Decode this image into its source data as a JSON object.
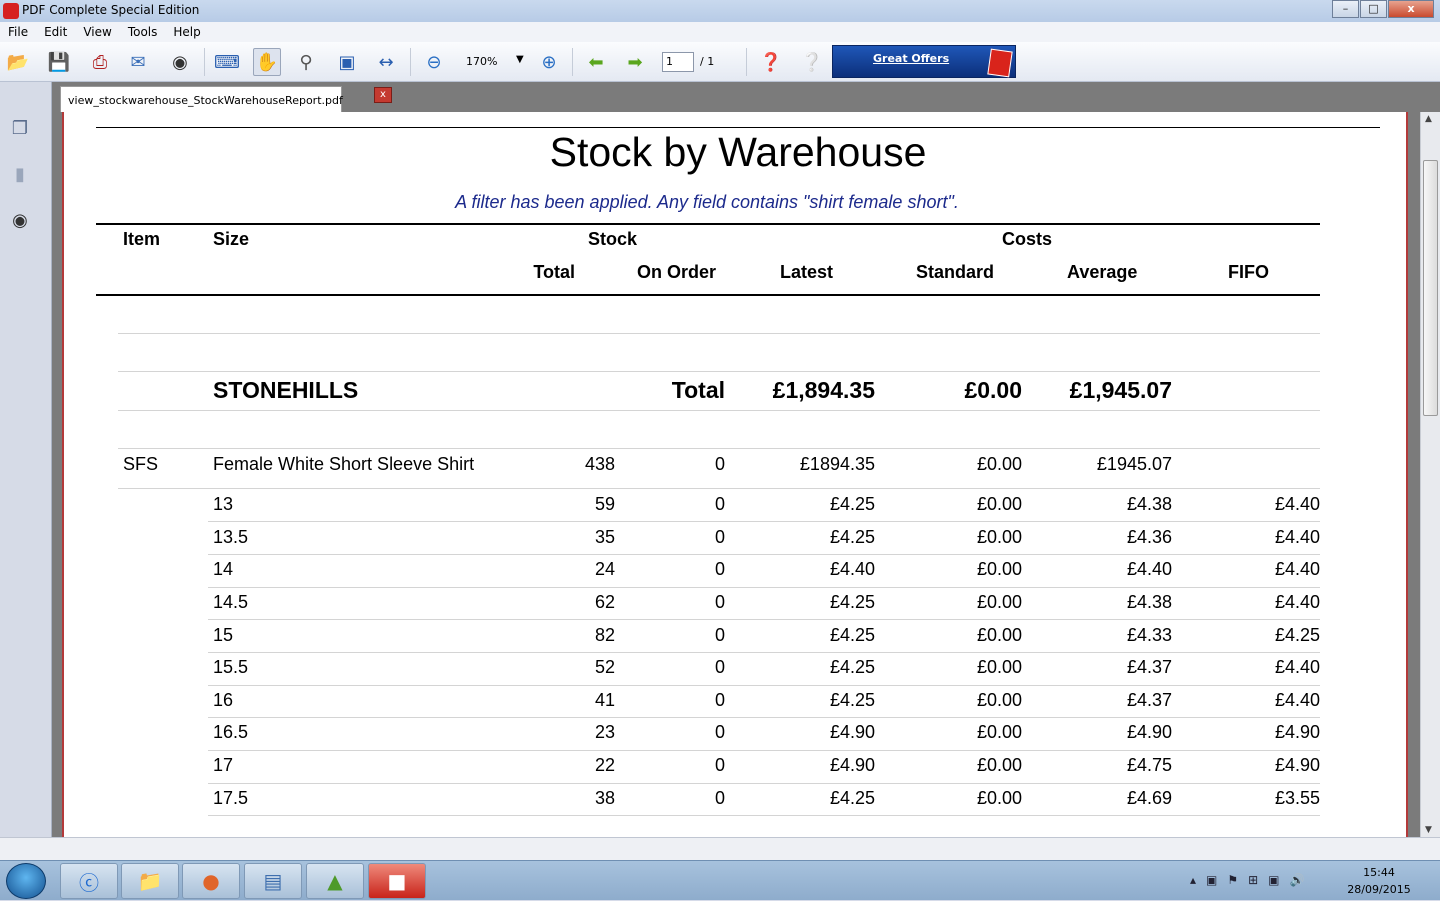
{
  "window": {
    "title": "PDF Complete Special Edition",
    "minimize": "–",
    "restore": "□",
    "close": "x"
  },
  "menu": [
    "File",
    "Edit",
    "View",
    "Tools",
    "Help"
  ],
  "toolbar": {
    "zoom": "170%",
    "page_current": "1",
    "page_total": "/ 1",
    "offers_label": "Great Offers"
  },
  "tab": {
    "filename": "view_stockwarehouse_StockWarehouseReport.pdf",
    "close": "x"
  },
  "report": {
    "title": "Stock by Warehouse",
    "filter_text": "A filter has been applied.  Any field contains  \"shirt female short\".",
    "headers": {
      "item": "Item",
      "size": "Size",
      "stock": "Stock",
      "costs": "Costs",
      "total": "Total",
      "on_order": "On Order",
      "latest": "Latest",
      "standard": "Standard",
      "average": "Average",
      "fifo": "FIFO"
    },
    "warehouse": {
      "name": "STONEHILLS",
      "total_label": "Total",
      "latest": "£1,894.35",
      "standard": "£0.00",
      "average": "£1,945.07"
    },
    "item": {
      "code": "SFS",
      "description": "Female White Short Sleeve Shirt",
      "total": "438",
      "on_order": "0",
      "latest": "£1894.35",
      "standard": "£0.00",
      "average": "£1945.07"
    },
    "rows": [
      {
        "size": "13",
        "total": "59",
        "on_order": "0",
        "latest": "£4.25",
        "standard": "£0.00",
        "average": "£4.38",
        "fifo": "£4.40"
      },
      {
        "size": "13.5",
        "total": "35",
        "on_order": "0",
        "latest": "£4.25",
        "standard": "£0.00",
        "average": "£4.36",
        "fifo": "£4.40"
      },
      {
        "size": "14",
        "total": "24",
        "on_order": "0",
        "latest": "£4.40",
        "standard": "£0.00",
        "average": "£4.40",
        "fifo": "£4.40"
      },
      {
        "size": "14.5",
        "total": "62",
        "on_order": "0",
        "latest": "£4.25",
        "standard": "£0.00",
        "average": "£4.38",
        "fifo": "£4.40"
      },
      {
        "size": "15",
        "total": "82",
        "on_order": "0",
        "latest": "£4.25",
        "standard": "£0.00",
        "average": "£4.33",
        "fifo": "£4.25"
      },
      {
        "size": "15.5",
        "total": "52",
        "on_order": "0",
        "latest": "£4.25",
        "standard": "£0.00",
        "average": "£4.37",
        "fifo": "£4.40"
      },
      {
        "size": "16",
        "total": "41",
        "on_order": "0",
        "latest": "£4.25",
        "standard": "£0.00",
        "average": "£4.37",
        "fifo": "£4.40"
      },
      {
        "size": "16.5",
        "total": "23",
        "on_order": "0",
        "latest": "£4.90",
        "standard": "£0.00",
        "average": "£4.90",
        "fifo": "£4.90"
      },
      {
        "size": "17",
        "total": "22",
        "on_order": "0",
        "latest": "£4.90",
        "standard": "£0.00",
        "average": "£4.75",
        "fifo": "£4.90"
      },
      {
        "size": "17.5",
        "total": "38",
        "on_order": "0",
        "latest": "£4.25",
        "standard": "£0.00",
        "average": "£4.69",
        "fifo": "£3.55"
      }
    ]
  },
  "taskbar": {
    "time": "15:44",
    "date": "28/09/2015"
  }
}
